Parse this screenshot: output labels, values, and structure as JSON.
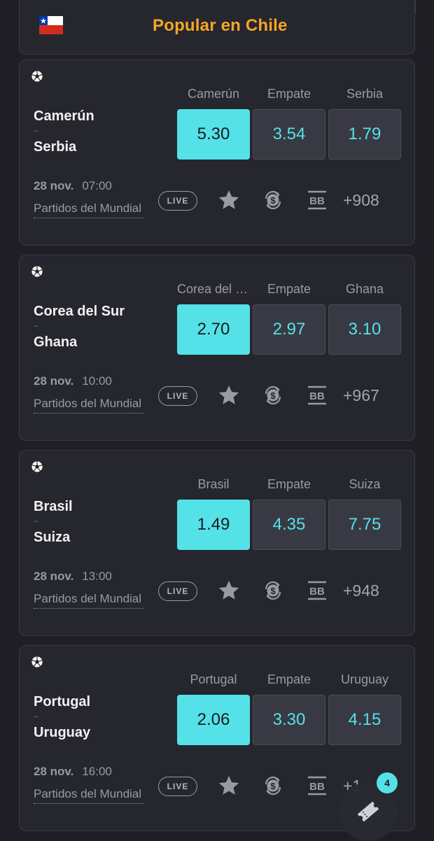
{
  "header": {
    "title": "Popular en Chile",
    "flag": "chile-flag-icon"
  },
  "colors": {
    "accent": "#54e2e8",
    "title": "#f5a623",
    "background": "#1e1e24",
    "card": "#26262e"
  },
  "matches": [
    {
      "sport_icon": "soccer-ball-icon",
      "home": "Camerún",
      "separator": "–",
      "away": "Serbia",
      "odds_labels": [
        "Camerún",
        "Empate",
        "Serbia"
      ],
      "odds": [
        "5.30",
        "3.54",
        "1.79"
      ],
      "selected_index": 0,
      "date": "28 nov.",
      "time": "07:00",
      "league": "Partidos del Mundial",
      "live_label": "LIVE",
      "more": "+908"
    },
    {
      "sport_icon": "soccer-ball-icon",
      "home": "Corea del Sur",
      "separator": "–",
      "away": "Ghana",
      "odds_labels": [
        "Corea del Sur",
        "Empate",
        "Ghana"
      ],
      "odds": [
        "2.70",
        "2.97",
        "3.10"
      ],
      "selected_index": 0,
      "date": "28 nov.",
      "time": "10:00",
      "league": "Partidos del Mundial",
      "live_label": "LIVE",
      "more": "+967"
    },
    {
      "sport_icon": "soccer-ball-icon",
      "home": "Brasil",
      "separator": "–",
      "away": "Suiza",
      "odds_labels": [
        "Brasil",
        "Empate",
        "Suiza"
      ],
      "odds": [
        "1.49",
        "4.35",
        "7.75"
      ],
      "selected_index": 0,
      "date": "28 nov.",
      "time": "13:00",
      "league": "Partidos del Mundial",
      "live_label": "LIVE",
      "more": "+948"
    },
    {
      "sport_icon": "soccer-ball-icon",
      "home": "Portugal",
      "separator": "–",
      "away": "Uruguay",
      "odds_labels": [
        "Portugal",
        "Empate",
        "Uruguay"
      ],
      "odds": [
        "2.06",
        "3.30",
        "4.15"
      ],
      "selected_index": 0,
      "date": "28 nov.",
      "time": "16:00",
      "league": "Partidos del Mundial",
      "live_label": "LIVE",
      "more": "+1"
    }
  ],
  "betslip": {
    "icon": "ticket-icon",
    "count": "4"
  }
}
